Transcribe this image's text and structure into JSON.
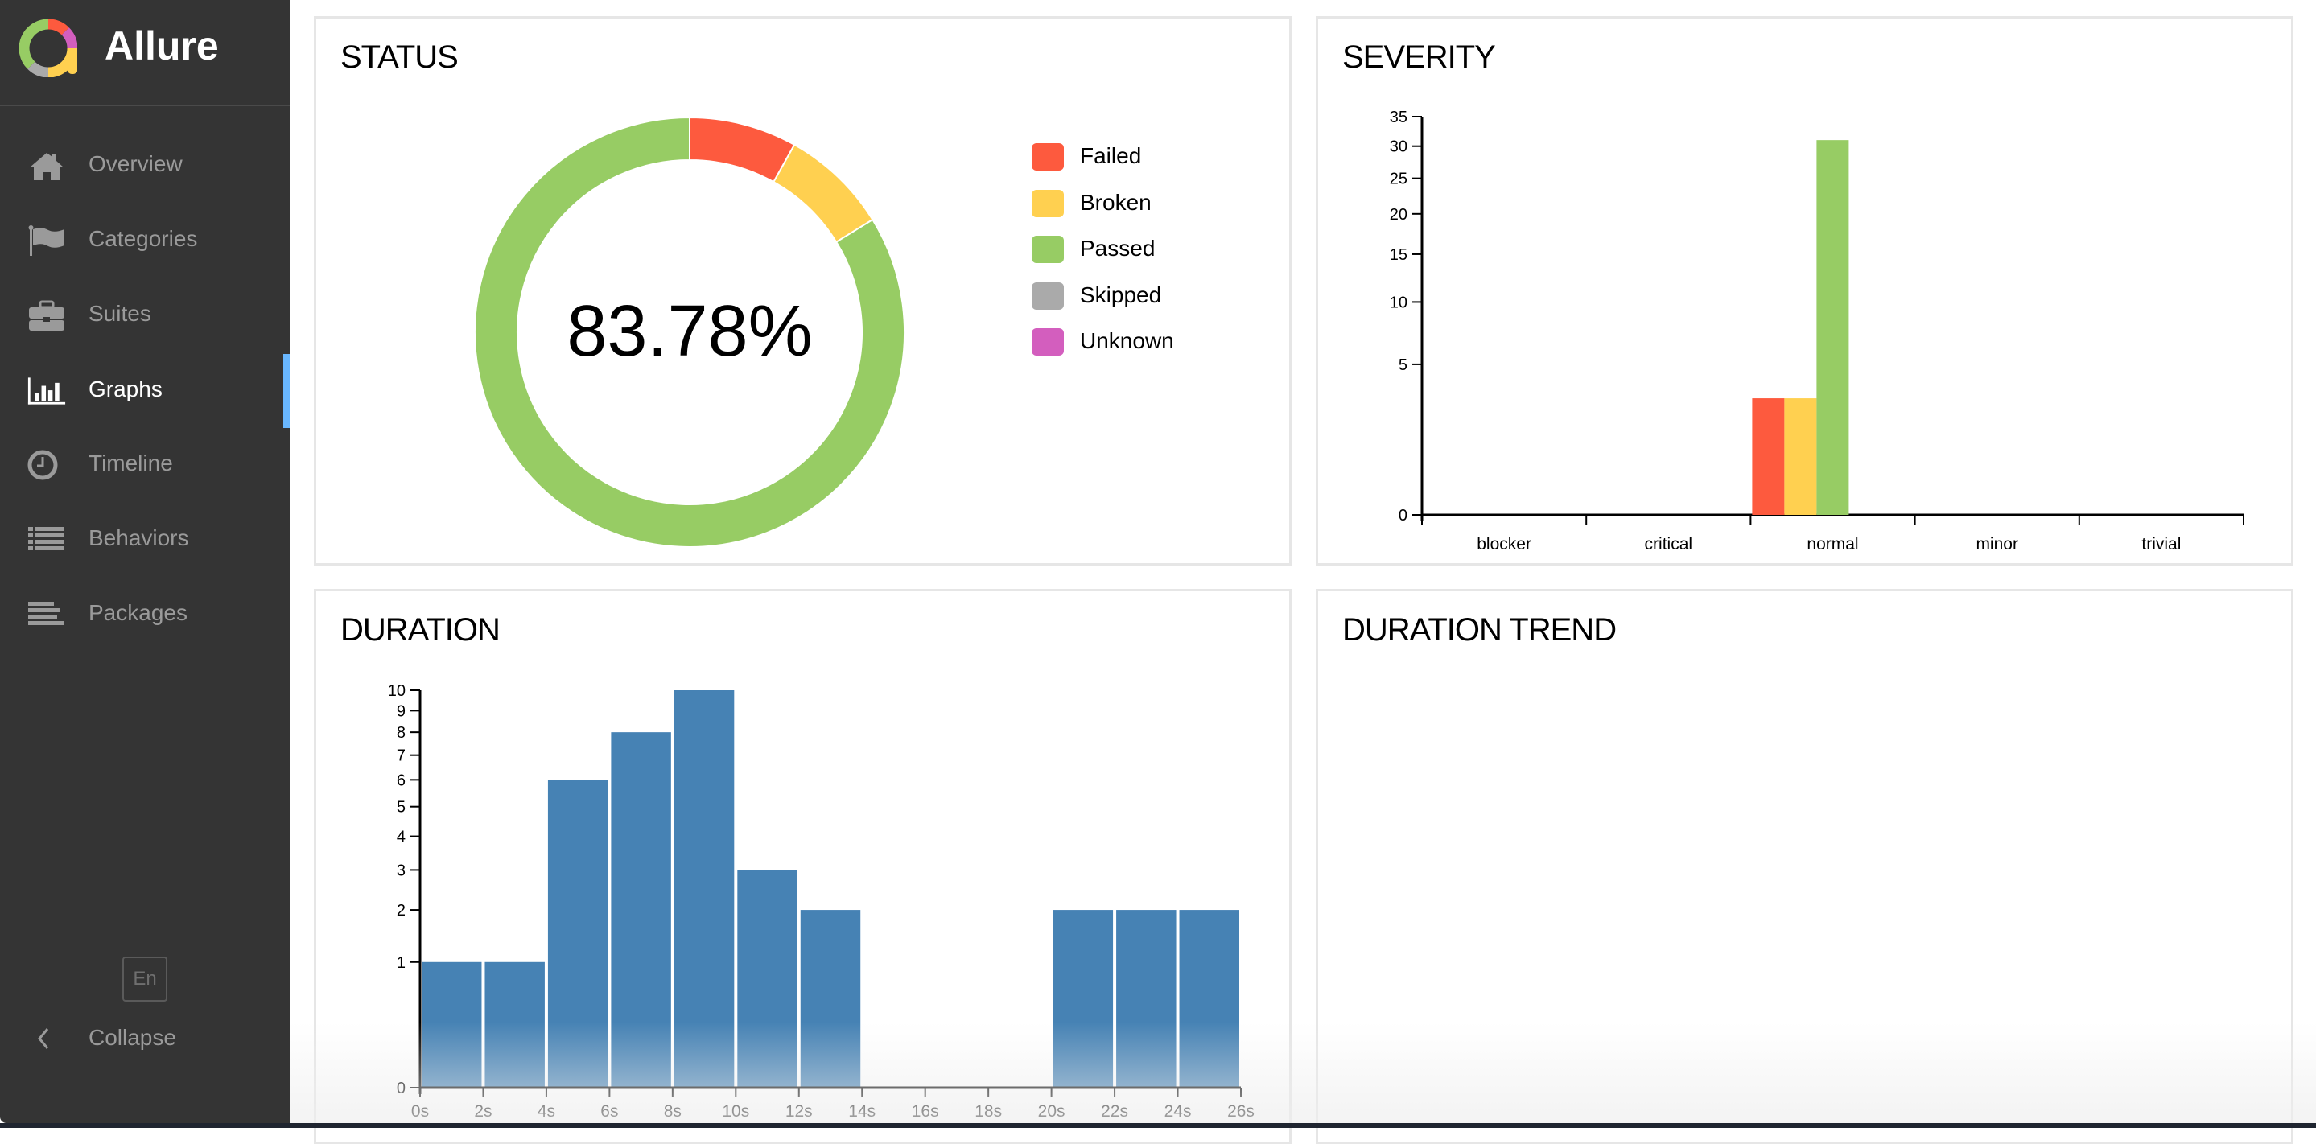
{
  "app": {
    "name": "Allure",
    "language_button": "En",
    "collapse_label": "Collapse"
  },
  "colors": {
    "failed": "#fd5a3e",
    "broken": "#ffd050",
    "passed": "#97cc64",
    "skipped": "#aaaaaa",
    "unknown": "#d35ebe",
    "duration_bar": "#4682b4",
    "sidebar_bg": "#343434",
    "active_indicator": "#69b7ff"
  },
  "sidebar": {
    "items": [
      {
        "label": "Overview",
        "icon": "home-icon",
        "active": false
      },
      {
        "label": "Categories",
        "icon": "flag-icon",
        "active": false
      },
      {
        "label": "Suites",
        "icon": "briefcase-icon",
        "active": false
      },
      {
        "label": "Graphs",
        "icon": "bar-chart-icon",
        "active": true
      },
      {
        "label": "Timeline",
        "icon": "clock-icon",
        "active": false
      },
      {
        "label": "Behaviors",
        "icon": "list-icon",
        "active": false
      },
      {
        "label": "Packages",
        "icon": "align-left-icon",
        "active": false
      }
    ]
  },
  "cards": {
    "status": {
      "title": "STATUS"
    },
    "severity": {
      "title": "SEVERITY"
    },
    "duration": {
      "title": "DURATION"
    },
    "duration_trend": {
      "title": "DURATION TREND"
    }
  },
  "chart_data": [
    {
      "type": "pie",
      "title": "STATUS",
      "donut": true,
      "center_label": "83.78%",
      "categories": [
        "Failed",
        "Broken",
        "Passed",
        "Skipped",
        "Unknown"
      ],
      "values": [
        3,
        3,
        31,
        0,
        0
      ],
      "legend": "right"
    },
    {
      "type": "bar",
      "title": "SEVERITY",
      "scale": "sqrt",
      "categories": [
        "blocker",
        "critical",
        "normal",
        "minor",
        "trivial"
      ],
      "series": [
        {
          "name": "Failed",
          "values": [
            0,
            0,
            3,
            0,
            0
          ]
        },
        {
          "name": "Broken",
          "values": [
            0,
            0,
            3,
            0,
            0
          ]
        },
        {
          "name": "Passed",
          "values": [
            0,
            0,
            31,
            0,
            0
          ]
        },
        {
          "name": "Skipped",
          "values": [
            0,
            0,
            0,
            0,
            0
          ]
        },
        {
          "name": "Unknown",
          "values": [
            0,
            0,
            0,
            0,
            0
          ]
        }
      ],
      "yticks": [
        0,
        5,
        10,
        15,
        20,
        25,
        30,
        35
      ],
      "ylim": [
        0,
        35
      ],
      "xlabel": "",
      "ylabel": ""
    },
    {
      "type": "bar",
      "title": "DURATION",
      "scale": "sqrt",
      "bins_seconds": [
        [
          0,
          2
        ],
        [
          2,
          4
        ],
        [
          4,
          6
        ],
        [
          6,
          8
        ],
        [
          8,
          10
        ],
        [
          10,
          12
        ],
        [
          12,
          14
        ],
        [
          14,
          16
        ],
        [
          16,
          18
        ],
        [
          18,
          20
        ],
        [
          20,
          22
        ],
        [
          22,
          24
        ],
        [
          24,
          26
        ]
      ],
      "values": [
        1,
        1,
        6,
        8,
        10,
        3,
        2,
        0,
        0,
        0,
        2,
        2,
        2
      ],
      "xticks": [
        "0s",
        "2s",
        "4s",
        "6s",
        "8s",
        "10s",
        "12s",
        "14s",
        "16s",
        "18s",
        "20s",
        "22s",
        "24s",
        "26s"
      ],
      "xlim": [
        0,
        26
      ],
      "yticks": [
        0,
        1,
        2,
        3,
        4,
        5,
        6,
        7,
        8,
        9,
        10
      ],
      "ylim": [
        0,
        10
      ],
      "xlabel": "",
      "ylabel": ""
    },
    {
      "type": "line",
      "title": "DURATION TREND",
      "series": []
    }
  ]
}
